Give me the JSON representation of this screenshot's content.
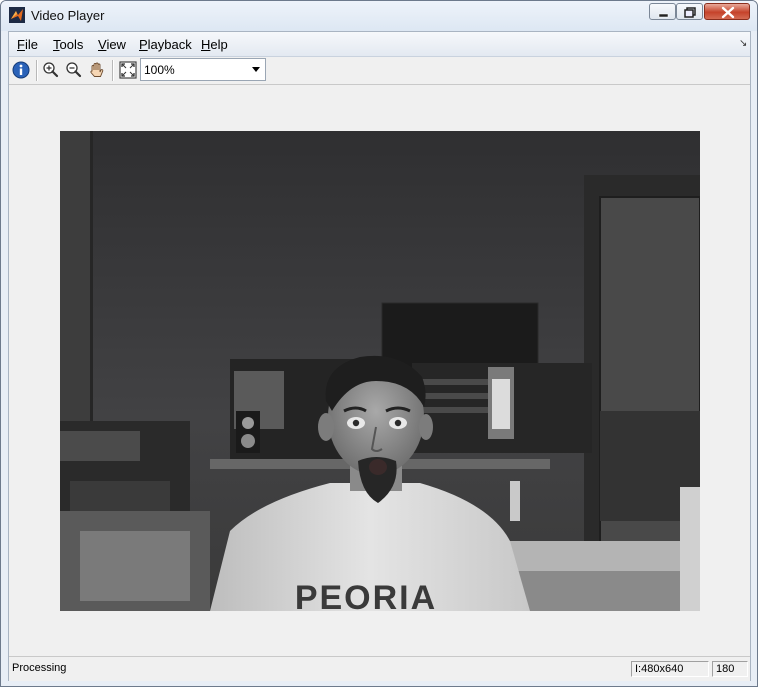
{
  "window": {
    "title": "Video Player"
  },
  "menu": {
    "items": [
      {
        "label_u": "F",
        "label_rest": "ile"
      },
      {
        "label_u": "T",
        "label_rest": "ools"
      },
      {
        "label_u": "V",
        "label_rest": "iew"
      },
      {
        "label_u": "P",
        "label_rest": "layback"
      },
      {
        "label_u": "H",
        "label_rest": "elp"
      }
    ]
  },
  "toolbar": {
    "icons": [
      "info-icon",
      "zoom-in-icon",
      "zoom-out-icon",
      "pan-hand-icon",
      "fit-to-window-icon"
    ],
    "zoom_value": "100%"
  },
  "video": {
    "shirt_text": "PEORIA"
  },
  "status": {
    "text": "Processing",
    "frame_info": "I:480x640",
    "frame_number": "180"
  },
  "colors": {
    "accent": "#d9541e",
    "close_button": "#c5432b"
  }
}
